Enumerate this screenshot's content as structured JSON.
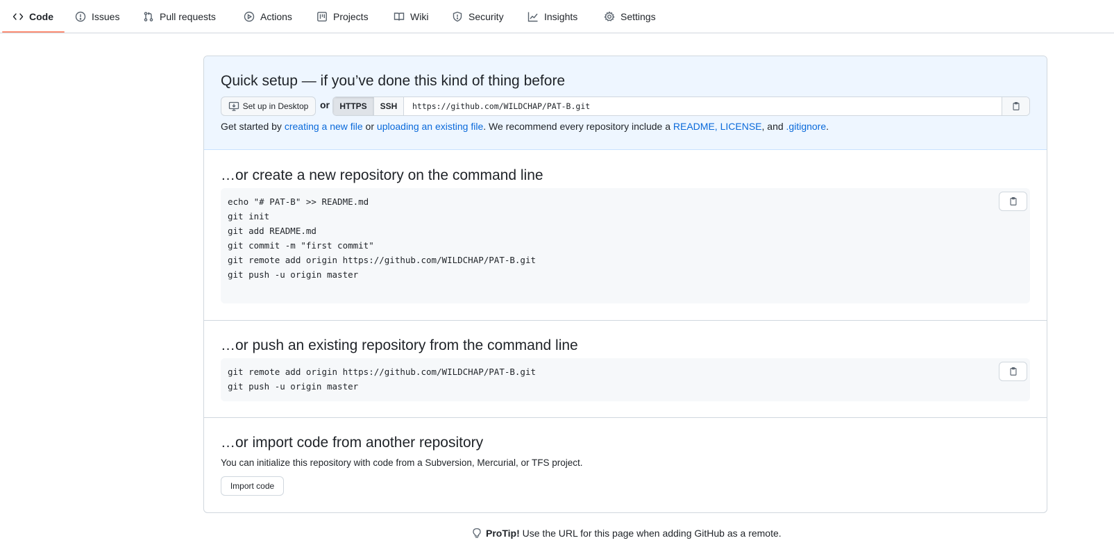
{
  "nav": {
    "tabs": [
      {
        "label": "Code",
        "icon": "code-icon",
        "active": true
      },
      {
        "label": "Issues",
        "icon": "issue-icon"
      },
      {
        "label": "Pull requests",
        "icon": "pull-request-icon"
      },
      {
        "label": "Actions",
        "icon": "play-icon"
      },
      {
        "label": "Projects",
        "icon": "project-board-icon"
      },
      {
        "label": "Wiki",
        "icon": "book-icon"
      },
      {
        "label": "Security",
        "icon": "shield-icon"
      },
      {
        "label": "Insights",
        "icon": "graph-icon"
      },
      {
        "label": "Settings",
        "icon": "gear-icon"
      }
    ]
  },
  "quick_setup": {
    "title": "Quick setup — if you’ve done this kind of thing before",
    "desktop_button": "Set up in Desktop",
    "or": "or",
    "https_label": "HTTPS",
    "ssh_label": "SSH",
    "clone_url": "https://github.com/WILDCHAP/PAT-B.git",
    "hint": {
      "p1": "Get started by ",
      "link1": "creating a new file",
      "p2": " or ",
      "link2": "uploading an existing file",
      "p3": ". We recommend every repository include a ",
      "link3": "README",
      "p4": ", ",
      "link4": "LICENSE",
      "p5": ", and ",
      "link5": ".gitignore",
      "p6": "."
    }
  },
  "create_section": {
    "title": "…or create a new repository on the command line",
    "lines": [
      "echo \"# PAT-B\" >> README.md",
      "git init",
      "git add README.md",
      "git commit -m \"first commit\"",
      "git remote add origin https://github.com/WILDCHAP/PAT-B.git",
      "git push -u origin master"
    ]
  },
  "push_section": {
    "title": "…or push an existing repository from the command line",
    "lines": [
      "git remote add origin https://github.com/WILDCHAP/PAT-B.git",
      "git push -u origin master"
    ]
  },
  "import_section": {
    "title": "…or import code from another repository",
    "description": "You can initialize this repository with code from a Subversion, Mercurial, or TFS project.",
    "button": "Import code"
  },
  "protip": {
    "bold": "ProTip!",
    "text": " Use the URL for this page when adding GitHub as a remote."
  },
  "colors": {
    "accent_underline": "#fd8c73",
    "link": "#0969da",
    "quick_bg": "#eef6ff",
    "code_bg": "#f6f8fa"
  }
}
